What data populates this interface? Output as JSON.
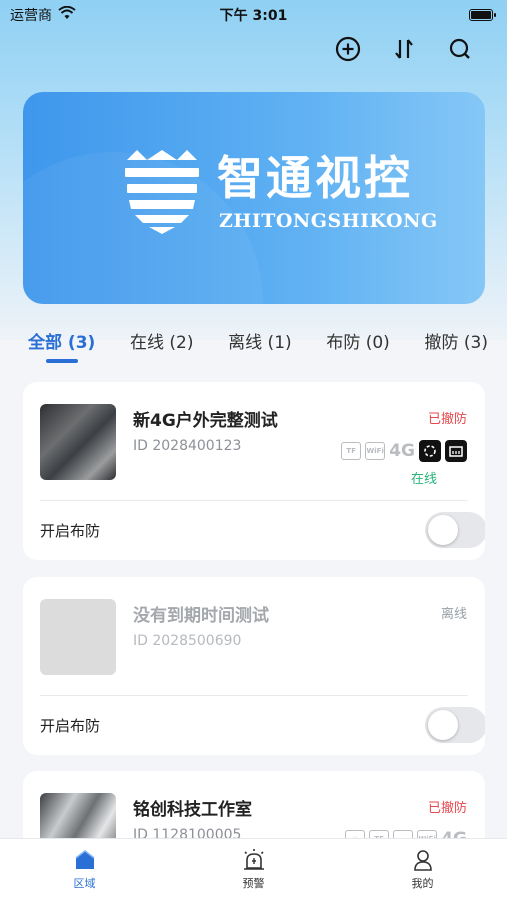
{
  "status_bar": {
    "carrier": "运营商",
    "time": "下午 3:01"
  },
  "banner": {
    "title": "智通视控",
    "subtitle": "ZHITONGSHIKONG"
  },
  "tabs": [
    {
      "label": "全部 (3)",
      "active": true
    },
    {
      "label": "在线 (2)",
      "active": false
    },
    {
      "label": "离线 (1)",
      "active": false
    },
    {
      "label": "布防 (0)",
      "active": false
    },
    {
      "label": "撤防 (3)",
      "active": false
    }
  ],
  "devices": [
    {
      "name": "新4G户外完整测试",
      "id": "ID 2028400123",
      "guard_status": "已撤防",
      "signal_label": "4G",
      "online_status": "在线",
      "arm_label": "开启布防",
      "arm_enabled": false
    },
    {
      "name": "没有到期时间测试",
      "id": "ID 2028500690",
      "guard_status": "离线",
      "arm_label": "开启布防",
      "arm_enabled": false
    },
    {
      "name": "铭创科技工作室",
      "id": "ID 1128100005",
      "guard_status": "已撤防",
      "signal_label": "4G"
    }
  ],
  "bottom_nav": [
    {
      "label": "区域",
      "icon": "home-icon",
      "active": true
    },
    {
      "label": "预警",
      "icon": "alarm-icon",
      "active": false
    },
    {
      "label": "我的",
      "icon": "user-icon",
      "active": false
    }
  ],
  "colors": {
    "accent": "#2a6fd6",
    "disarmed": "#e5484d",
    "online": "#27b37a"
  }
}
